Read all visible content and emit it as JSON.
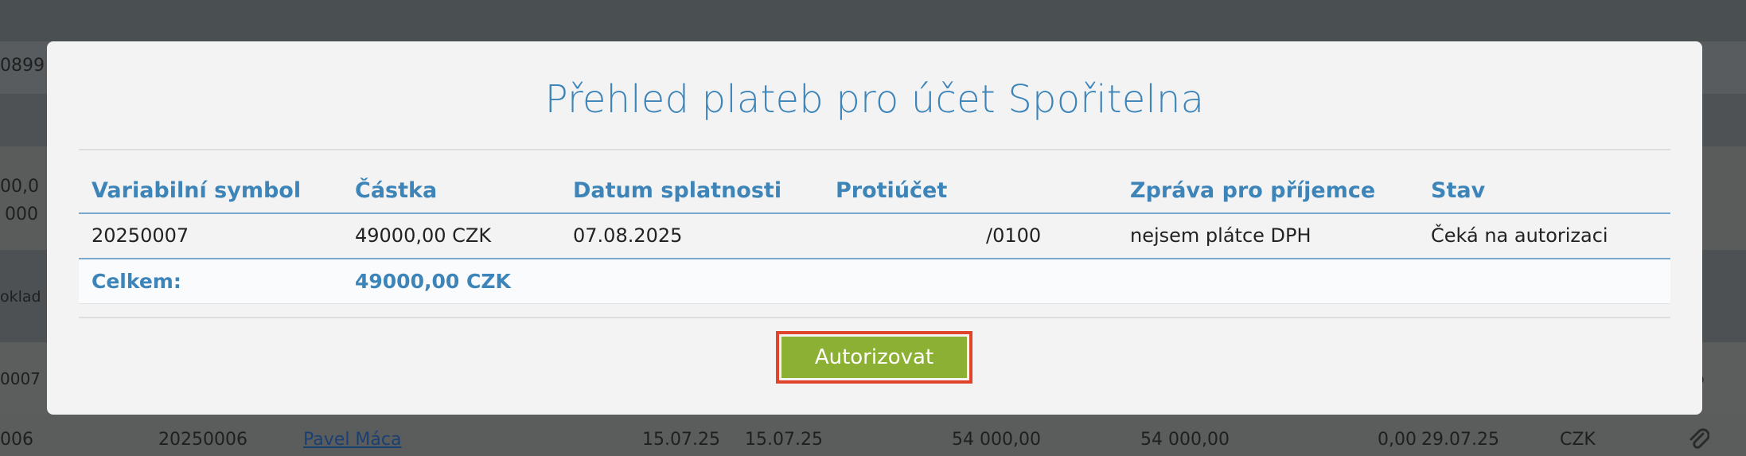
{
  "background": {
    "left_fragments": [
      "0899",
      "00,0",
      "000",
      "oklad",
      "0007",
      "006"
    ],
    "row": {
      "vs": "20250006",
      "name": "Pavel Máca",
      "date1": "15.07.25",
      "date2": "15.07.25",
      "amount1": "54 000,00",
      "amount2": "54 000,00",
      "zero": "0,00",
      "date3": "29.07.25",
      "currency": "CZK"
    }
  },
  "modal": {
    "title": "Přehled plateb pro účet Spořitelna",
    "table": {
      "headers": [
        "Variabilní symbol",
        "Částka",
        "Datum splatnosti",
        "Protiúčet",
        "Zpráva pro příjemce",
        "Stav"
      ],
      "rows": [
        {
          "vs": "20250007",
          "amount": "49000,00 CZK",
          "due_date": "07.08.2025",
          "account": "/0100",
          "message": "nejsem plátce DPH",
          "status": "Čeká na autorizaci"
        }
      ],
      "total_label": "Celkem:",
      "total_amount": "49000,00 CZK"
    },
    "authorize_label": "Autorizovat"
  },
  "colors": {
    "accent": "#3d84b8",
    "button": "#8cb033",
    "highlight": "#e0442a",
    "backdrop": "#4a4f52"
  }
}
